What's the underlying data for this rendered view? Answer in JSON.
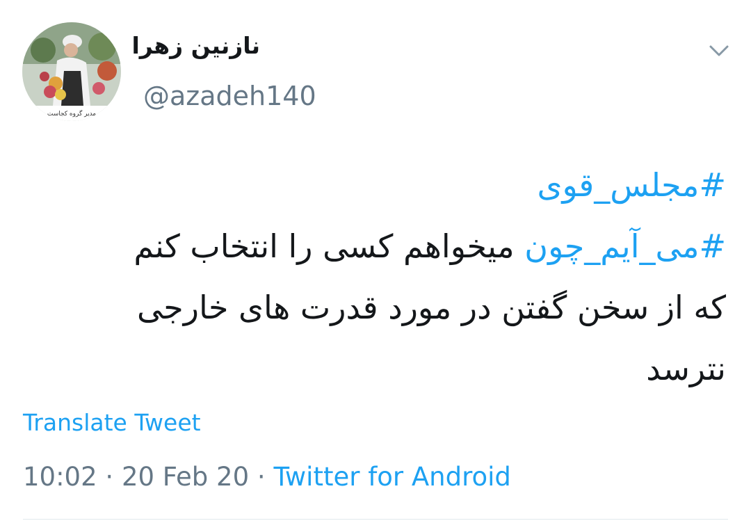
{
  "tweet": {
    "display_name": "نازنین زهرا",
    "handle": "@azadeh140",
    "avatar_caption": "مدیر گروه کجاست",
    "caret_icon": "chevron-down-icon",
    "lines": {
      "hashtag1": "#مجلس_قوی",
      "hashtag2": "#می_آیم_چون",
      "line2_rest": " میخواهم کسی را انتخاب کنم",
      "line3": "که از سخن گفتن در مورد قدرت های خارجی",
      "line4": "نترسد"
    },
    "translate_label": "Translate Tweet",
    "time": "10:02",
    "separator": " · ",
    "date": "20 Feb 20",
    "source": "Twitter for Android"
  },
  "colors": {
    "link": "#1da1f2",
    "secondary": "#657786",
    "text": "#14171a",
    "divider": "#e1e8ed"
  }
}
